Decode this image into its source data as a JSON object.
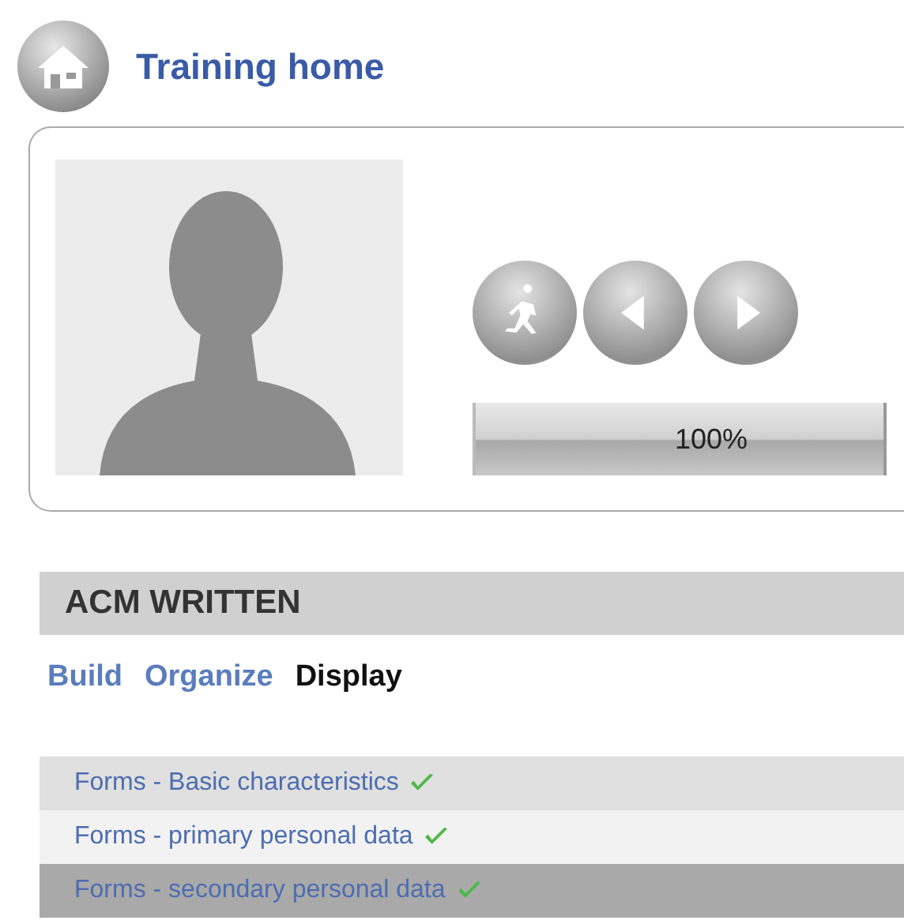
{
  "header": {
    "title": "Training home"
  },
  "player": {
    "progress": {
      "level": 1,
      "reading": "100%"
    }
  },
  "course": {
    "title": "ACM WRITTEN",
    "tabs": [
      {
        "label": "Build",
        "selected": false
      },
      {
        "label": "Organize",
        "selected": false
      },
      {
        "label": "Display",
        "selected": true
      }
    ],
    "lessons": [
      {
        "label": "Forms - Basic characteristics",
        "completed": true,
        "selected": false
      },
      {
        "label": "Forms - primary personal data",
        "completed": true,
        "selected": false
      },
      {
        "label": "Forms - secondary personal data",
        "completed": true,
        "selected": true
      }
    ]
  }
}
